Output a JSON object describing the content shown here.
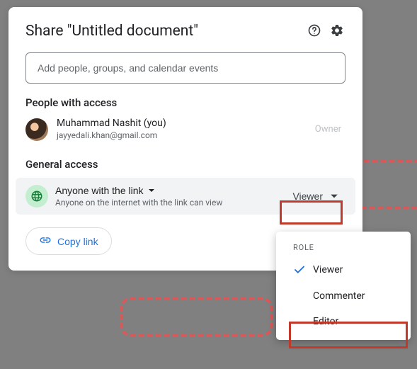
{
  "dialog": {
    "title": "Share \"Untitled document\"",
    "search_placeholder": "Add people, groups, and calendar events",
    "people_section_title": "People with access",
    "general_section_title": "General access"
  },
  "person": {
    "name": "Muhammad Nashit (you)",
    "email": "jayyedali.khan@gmail.com",
    "role": "Owner"
  },
  "general": {
    "scope": "Anyone with the link",
    "description": "Anyone on the internet with the link can view",
    "role": "Viewer"
  },
  "copy_link_label": "Copy link",
  "role_menu": {
    "header": "ROLE",
    "items": [
      "Viewer",
      "Commenter",
      "Editor"
    ],
    "selected": "Viewer"
  }
}
